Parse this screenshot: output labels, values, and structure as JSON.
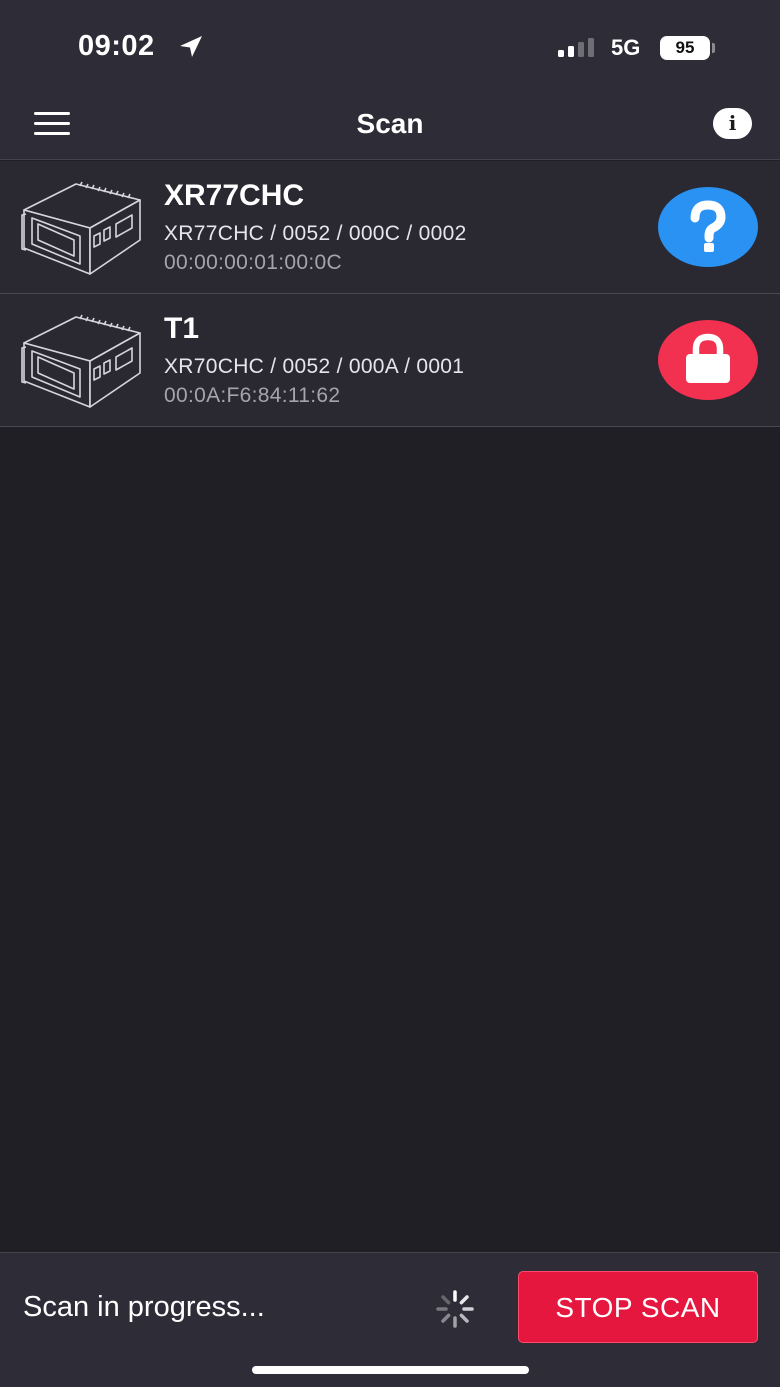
{
  "status_bar": {
    "time": "09:02",
    "network": "5G",
    "battery": "95"
  },
  "nav": {
    "title": "Scan",
    "info_icon_glyph": "i"
  },
  "devices": [
    {
      "name": "XR77CHC",
      "model_info": "XR77CHC / 0052 / 000C / 0002",
      "mac": "00:00:00:01:00:0C",
      "status": "unknown",
      "status_icon": "question-icon",
      "status_color": "#2a92f2"
    },
    {
      "name": "T1",
      "model_info": "XR70CHC / 0052 / 000A / 0001",
      "mac": "00:0A:F6:84:11:62",
      "status": "locked",
      "status_icon": "lock-icon",
      "status_color": "#f2304f"
    }
  ],
  "bottom": {
    "status_text": "Scan in progress...",
    "stop_label": "STOP SCAN"
  }
}
